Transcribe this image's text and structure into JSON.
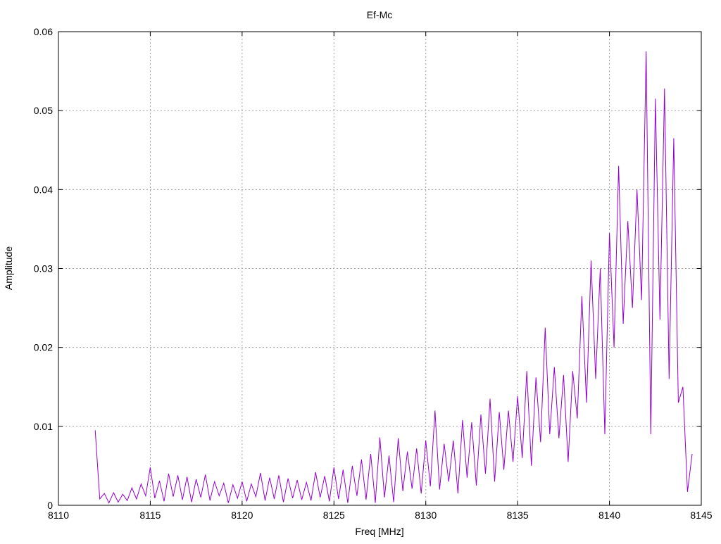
{
  "chart_data": {
    "type": "line",
    "title": "Ef-Mc",
    "xlabel": "Freq [MHz]",
    "ylabel": "Amplitude",
    "xlim": [
      8110,
      8145
    ],
    "ylim": [
      0,
      0.06
    ],
    "xticks": [
      "8110",
      "8115",
      "8120",
      "8125",
      "8130",
      "8135",
      "8140",
      "8145"
    ],
    "xtick_values": [
      8110,
      8115,
      8120,
      8125,
      8130,
      8135,
      8140,
      8145
    ],
    "yticks": [
      "0",
      "0.01",
      "0.02",
      "0.03",
      "0.04",
      "0.05",
      "0.06"
    ],
    "ytick_values": [
      0,
      0.01,
      0.02,
      0.03,
      0.04,
      0.05,
      0.06
    ],
    "grid": true,
    "legend": "none",
    "series": [
      {
        "name": "Ef-Mc",
        "color": "#9400d3",
        "x_start": 8112.0,
        "x_step": 0.25,
        "values": [
          0.0095,
          0.0008,
          0.0015,
          0.0003,
          0.0016,
          0.0004,
          0.0014,
          0.0006,
          0.0022,
          0.0008,
          0.0027,
          0.0012,
          0.0048,
          0.0009,
          0.0031,
          0.0005,
          0.004,
          0.0011,
          0.0038,
          0.0007,
          0.0036,
          0.0004,
          0.0033,
          0.001,
          0.0039,
          0.0006,
          0.003,
          0.0012,
          0.0028,
          0.0003,
          0.0026,
          0.0009,
          0.003,
          0.0005,
          0.0027,
          0.0011,
          0.0041,
          0.0006,
          0.0035,
          0.0008,
          0.0038,
          0.0004,
          0.0034,
          0.0009,
          0.0032,
          0.0007,
          0.0029,
          0.0006,
          0.0042,
          0.001,
          0.0037,
          0.0005,
          0.0048,
          0.0008,
          0.0045,
          0.0003,
          0.005,
          0.0012,
          0.0058,
          0.0007,
          0.0065,
          0.0003,
          0.0086,
          0.001,
          0.0063,
          0.0004,
          0.0085,
          0.0018,
          0.0068,
          0.0021,
          0.0072,
          0.0015,
          0.0082,
          0.0024,
          0.012,
          0.002,
          0.0078,
          0.003,
          0.0082,
          0.0015,
          0.0108,
          0.0035,
          0.0105,
          0.0025,
          0.0115,
          0.004,
          0.0135,
          0.003,
          0.0118,
          0.0045,
          0.012,
          0.0055,
          0.0138,
          0.006,
          0.017,
          0.005,
          0.0162,
          0.008,
          0.0225,
          0.009,
          0.0175,
          0.0085,
          0.0165,
          0.0055,
          0.017,
          0.011,
          0.0265,
          0.013,
          0.031,
          0.016,
          0.03,
          0.009,
          0.0345,
          0.02,
          0.043,
          0.023,
          0.036,
          0.025,
          0.04,
          0.026,
          0.0575,
          0.009,
          0.0515,
          0.0235,
          0.0528,
          0.016,
          0.0465,
          0.013,
          0.015,
          0.0017,
          0.0065
        ]
      }
    ]
  }
}
